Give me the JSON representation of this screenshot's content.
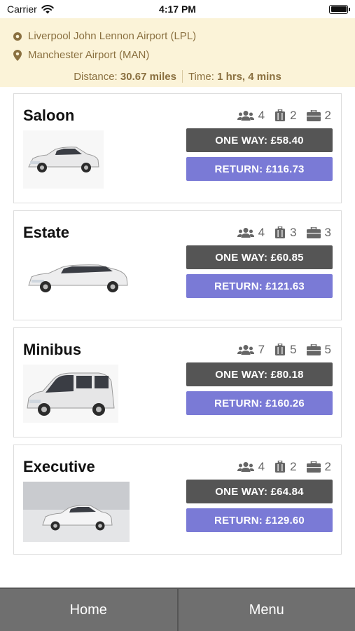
{
  "status": {
    "carrier": "Carrier",
    "time": "4:17 PM"
  },
  "route": {
    "from": "Liverpool John Lennon Airport (LPL)",
    "to": "Manchester Airport (MAN)",
    "distance_label": "Distance:",
    "distance_value": "30.67 miles",
    "time_label": "Time:",
    "time_value": "1 hrs, 4 mins"
  },
  "vehicles": [
    {
      "name": "Saloon",
      "passengers": "4",
      "luggage": "2",
      "hand_luggage": "2",
      "one_way": "ONE WAY: £58.40",
      "return": "RETURN: £116.73"
    },
    {
      "name": "Estate",
      "passengers": "4",
      "luggage": "3",
      "hand_luggage": "3",
      "one_way": "ONE WAY: £60.85",
      "return": "RETURN: £121.63"
    },
    {
      "name": "Minibus",
      "passengers": "7",
      "luggage": "5",
      "hand_luggage": "5",
      "one_way": "ONE WAY: £80.18",
      "return": "RETURN: £160.26"
    },
    {
      "name": "Executive",
      "passengers": "4",
      "luggage": "2",
      "hand_luggage": "2",
      "one_way": "ONE WAY: £64.84",
      "return": "RETURN: £129.60"
    }
  ],
  "tabs": {
    "home": "Home",
    "menu": "Menu"
  },
  "colors": {
    "route_bg": "#fbf3d8",
    "one_way_button": "#555555",
    "return_button": "#7a7ad6",
    "tabbar": "#6f6f6f"
  }
}
